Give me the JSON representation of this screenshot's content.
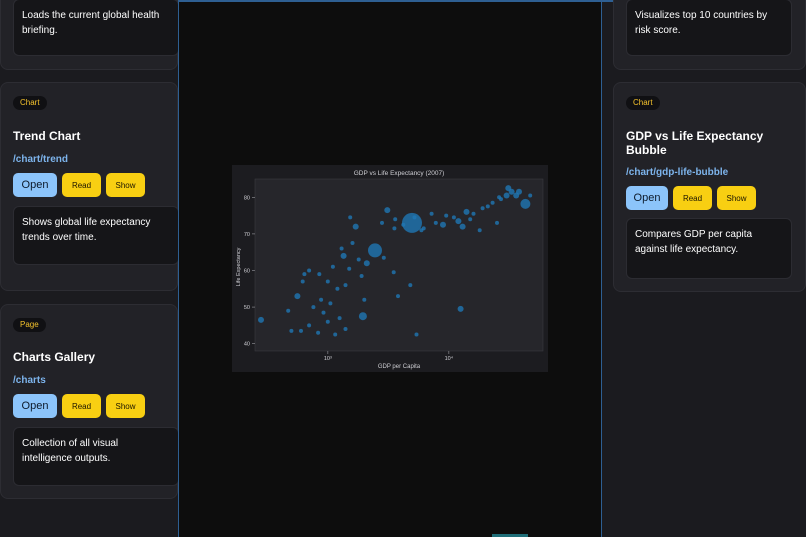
{
  "left_cards": [
    {
      "desc": "Loads the current global health briefing."
    },
    {
      "badge": "Chart",
      "title": "Trend Chart",
      "route": "/chart/trend",
      "open": "Open",
      "read": "Read",
      "show": "Show",
      "desc": "Shows global life expectancy trends over time."
    },
    {
      "badge": "Page",
      "title": "Charts Gallery",
      "route": "/charts",
      "open": "Open",
      "read": "Read",
      "show": "Show",
      "desc": "Collection of all visual intelligence outputs."
    }
  ],
  "right_cards": [
    {
      "desc": "Visualizes top 10 countries by risk score."
    },
    {
      "badge": "Chart",
      "title": "GDP vs Life Expectancy Bubble",
      "route": "/chart/gdp-life-bubble",
      "open": "Open",
      "read": "Read",
      "show": "Show",
      "desc": "Compares GDP per capita against life expectancy."
    }
  ],
  "colors": {
    "accent_blue": "#8cc4fa",
    "accent_yellow": "#f8cf12",
    "route_blue": "#7db4ec",
    "bubble": "#1f77b4"
  },
  "chart_data": {
    "type": "scatter",
    "title": "GDP vs Life Expectancy (2007)",
    "xlabel": "GDP per Capita",
    "ylabel": "Life Expectancy",
    "xscale": "log",
    "xlim": [
      250,
      60000
    ],
    "ylim": [
      38,
      85
    ],
    "x_ticks": [
      1000,
      10000
    ],
    "x_tick_labels": [
      "10³",
      "10⁴"
    ],
    "y_ticks": [
      40,
      50,
      60,
      70,
      80
    ],
    "grid": false,
    "legend": "none",
    "points": [
      {
        "x": 2452,
        "y": 65.5,
        "size": 7
      },
      {
        "x": 4959,
        "y": 73.0,
        "size": 10
      },
      {
        "x": 1530,
        "y": 74.5,
        "size": 2
      },
      {
        "x": 3548,
        "y": 71.5,
        "size": 2
      },
      {
        "x": 5937,
        "y": 71.0,
        "size": 2
      },
      {
        "x": 8948,
        "y": 72.5,
        "size": 3
      },
      {
        "x": 12000,
        "y": 73.5,
        "size": 3
      },
      {
        "x": 14000,
        "y": 76.0,
        "size": 3
      },
      {
        "x": 9500,
        "y": 75.0,
        "size": 2
      },
      {
        "x": 7800,
        "y": 73.0,
        "size": 2
      },
      {
        "x": 6200,
        "y": 71.5,
        "size": 2
      },
      {
        "x": 11000,
        "y": 74.5,
        "size": 2
      },
      {
        "x": 16000,
        "y": 75.5,
        "size": 2
      },
      {
        "x": 21000,
        "y": 77.5,
        "size": 2
      },
      {
        "x": 23000,
        "y": 78.5,
        "size": 2
      },
      {
        "x": 27000,
        "y": 79.5,
        "size": 2
      },
      {
        "x": 30000,
        "y": 80.5,
        "size": 3
      },
      {
        "x": 33000,
        "y": 81.5,
        "size": 3
      },
      {
        "x": 36000,
        "y": 80.5,
        "size": 3
      },
      {
        "x": 31000,
        "y": 82.5,
        "size": 3
      },
      {
        "x": 38000,
        "y": 81.5,
        "size": 3
      },
      {
        "x": 42951,
        "y": 78.2,
        "size": 5
      },
      {
        "x": 26000,
        "y": 80.0,
        "size": 2
      },
      {
        "x": 19000,
        "y": 77.0,
        "size": 2
      },
      {
        "x": 47000,
        "y": 80.5,
        "size": 2
      },
      {
        "x": 13000,
        "y": 72.0,
        "size": 3
      },
      {
        "x": 15000,
        "y": 74.0,
        "size": 2
      },
      {
        "x": 25000,
        "y": 73.0,
        "size": 2
      },
      {
        "x": 18000,
        "y": 71.0,
        "size": 2
      },
      {
        "x": 1700,
        "y": 72.0,
        "size": 3
      },
      {
        "x": 2800,
        "y": 73.0,
        "size": 2
      },
      {
        "x": 3600,
        "y": 74.0,
        "size": 2
      },
      {
        "x": 4200,
        "y": 72.5,
        "size": 2
      },
      {
        "x": 5200,
        "y": 74.5,
        "size": 2
      },
      {
        "x": 7200,
        "y": 75.5,
        "size": 2
      },
      {
        "x": 1800,
        "y": 63.0,
        "size": 2
      },
      {
        "x": 1500,
        "y": 60.5,
        "size": 2
      },
      {
        "x": 1100,
        "y": 61.0,
        "size": 2
      },
      {
        "x": 850,
        "y": 59.0,
        "size": 2
      },
      {
        "x": 2100,
        "y": 62.0,
        "size": 3
      },
      {
        "x": 2900,
        "y": 63.5,
        "size": 2
      },
      {
        "x": 3500,
        "y": 59.5,
        "size": 2
      },
      {
        "x": 1300,
        "y": 66.0,
        "size": 2
      },
      {
        "x": 1600,
        "y": 67.5,
        "size": 2
      },
      {
        "x": 1350,
        "y": 64.0,
        "size": 3
      },
      {
        "x": 700,
        "y": 60.0,
        "size": 2
      },
      {
        "x": 620,
        "y": 57.0,
        "size": 2
      },
      {
        "x": 1000,
        "y": 57.0,
        "size": 2
      },
      {
        "x": 1200,
        "y": 55.0,
        "size": 2
      },
      {
        "x": 1400,
        "y": 56.0,
        "size": 2
      },
      {
        "x": 1900,
        "y": 58.5,
        "size": 2
      },
      {
        "x": 560,
        "y": 53.0,
        "size": 3
      },
      {
        "x": 880,
        "y": 52.0,
        "size": 2
      },
      {
        "x": 1050,
        "y": 51.0,
        "size": 2
      },
      {
        "x": 760,
        "y": 50.0,
        "size": 2
      },
      {
        "x": 920,
        "y": 48.5,
        "size": 2
      },
      {
        "x": 1250,
        "y": 47.0,
        "size": 2
      },
      {
        "x": 1950,
        "y": 47.5,
        "size": 4
      },
      {
        "x": 700,
        "y": 45.0,
        "size": 2
      },
      {
        "x": 600,
        "y": 43.5,
        "size": 2
      },
      {
        "x": 830,
        "y": 43.0,
        "size": 2
      },
      {
        "x": 1000,
        "y": 46.0,
        "size": 2
      },
      {
        "x": 1400,
        "y": 44.0,
        "size": 2
      },
      {
        "x": 1150,
        "y": 42.5,
        "size": 2
      },
      {
        "x": 470,
        "y": 49.0,
        "size": 2
      },
      {
        "x": 500,
        "y": 43.5,
        "size": 2
      },
      {
        "x": 280,
        "y": 46.5,
        "size": 3
      },
      {
        "x": 3800,
        "y": 53.0,
        "size": 2
      },
      {
        "x": 5400,
        "y": 42.5,
        "size": 2
      },
      {
        "x": 12500,
        "y": 49.5,
        "size": 3
      },
      {
        "x": 4800,
        "y": 56.0,
        "size": 2
      },
      {
        "x": 2000,
        "y": 52.0,
        "size": 2
      },
      {
        "x": 640,
        "y": 59.0,
        "size": 2
      },
      {
        "x": 3100,
        "y": 76.5,
        "size": 3
      }
    ]
  }
}
